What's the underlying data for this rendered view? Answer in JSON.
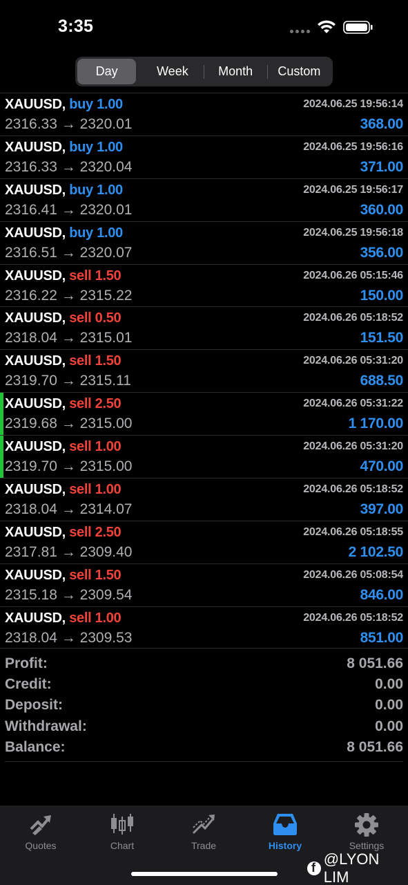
{
  "status_bar": {
    "time": "3:35"
  },
  "period_tabs": [
    "Day",
    "Week",
    "Month",
    "Custom"
  ],
  "active_period": "Day",
  "trades": [
    {
      "symbol": "XAUUSD,",
      "side": "buy",
      "volume": "1.00",
      "time": "2024.06.25 19:56:14",
      "prices": "2316.33 → 2320.01",
      "profit": "368.00",
      "marked": false
    },
    {
      "symbol": "XAUUSD,",
      "side": "buy",
      "volume": "1.00",
      "time": "2024.06.25 19:56:16",
      "prices": "2316.33 → 2320.04",
      "profit": "371.00",
      "marked": false
    },
    {
      "symbol": "XAUUSD,",
      "side": "buy",
      "volume": "1.00",
      "time": "2024.06.25 19:56:17",
      "prices": "2316.41 → 2320.01",
      "profit": "360.00",
      "marked": false
    },
    {
      "symbol": "XAUUSD,",
      "side": "buy",
      "volume": "1.00",
      "time": "2024.06.25 19:56:18",
      "prices": "2316.51 → 2320.07",
      "profit": "356.00",
      "marked": false
    },
    {
      "symbol": "XAUUSD,",
      "side": "sell",
      "volume": "1.50",
      "time": "2024.06.26 05:15:46",
      "prices": "2316.22 → 2315.22",
      "profit": "150.00",
      "marked": false
    },
    {
      "symbol": "XAUUSD,",
      "side": "sell",
      "volume": "0.50",
      "time": "2024.06.26 05:18:52",
      "prices": "2318.04 → 2315.01",
      "profit": "151.50",
      "marked": false
    },
    {
      "symbol": "XAUUSD,",
      "side": "sell",
      "volume": "1.50",
      "time": "2024.06.26 05:31:20",
      "prices": "2319.70 → 2315.11",
      "profit": "688.50",
      "marked": false
    },
    {
      "symbol": "XAUUSD,",
      "side": "sell",
      "volume": "2.50",
      "time": "2024.06.26 05:31:22",
      "prices": "2319.68 → 2315.00",
      "profit": "1 170.00",
      "marked": true
    },
    {
      "symbol": "XAUUSD,",
      "side": "sell",
      "volume": "1.00",
      "time": "2024.06.26 05:31:20",
      "prices": "2319.70 → 2315.00",
      "profit": "470.00",
      "marked": true
    },
    {
      "symbol": "XAUUSD,",
      "side": "sell",
      "volume": "1.00",
      "time": "2024.06.26 05:18:52",
      "prices": "2318.04 → 2314.07",
      "profit": "397.00",
      "marked": false
    },
    {
      "symbol": "XAUUSD,",
      "side": "sell",
      "volume": "2.50",
      "time": "2024.06.26 05:18:55",
      "prices": "2317.81 → 2309.40",
      "profit": "2 102.50",
      "marked": false
    },
    {
      "symbol": "XAUUSD,",
      "side": "sell",
      "volume": "1.50",
      "time": "2024.06.26 05:08:54",
      "prices": "2315.18 → 2309.54",
      "profit": "846.00",
      "marked": false
    },
    {
      "symbol": "XAUUSD,",
      "side": "sell",
      "volume": "1.00",
      "time": "2024.06.26 05:18:52",
      "prices": "2318.04 → 2309.53",
      "profit": "851.00",
      "marked": false
    }
  ],
  "summary": [
    {
      "label": "Profit:",
      "value": "8 051.66"
    },
    {
      "label": "Credit:",
      "value": "0.00"
    },
    {
      "label": "Deposit:",
      "value": "0.00"
    },
    {
      "label": "Withdrawal:",
      "value": "0.00"
    },
    {
      "label": "Balance:",
      "value": "8 051.66"
    }
  ],
  "tab_bar": [
    {
      "label": "Quotes",
      "icon": "quotes-icon"
    },
    {
      "label": "Chart",
      "icon": "chart-icon"
    },
    {
      "label": "Trade",
      "icon": "trade-icon"
    },
    {
      "label": "History",
      "icon": "history-icon",
      "active": true
    },
    {
      "label": "Settings",
      "icon": "settings-icon"
    }
  ],
  "watermark": "@LYON LIM",
  "colors": {
    "buy": "#2f8ff0",
    "sell": "#f0423a",
    "profit": "#2f8ff0",
    "marker": "#22c33a",
    "active_tab": "#2f8ff0"
  }
}
